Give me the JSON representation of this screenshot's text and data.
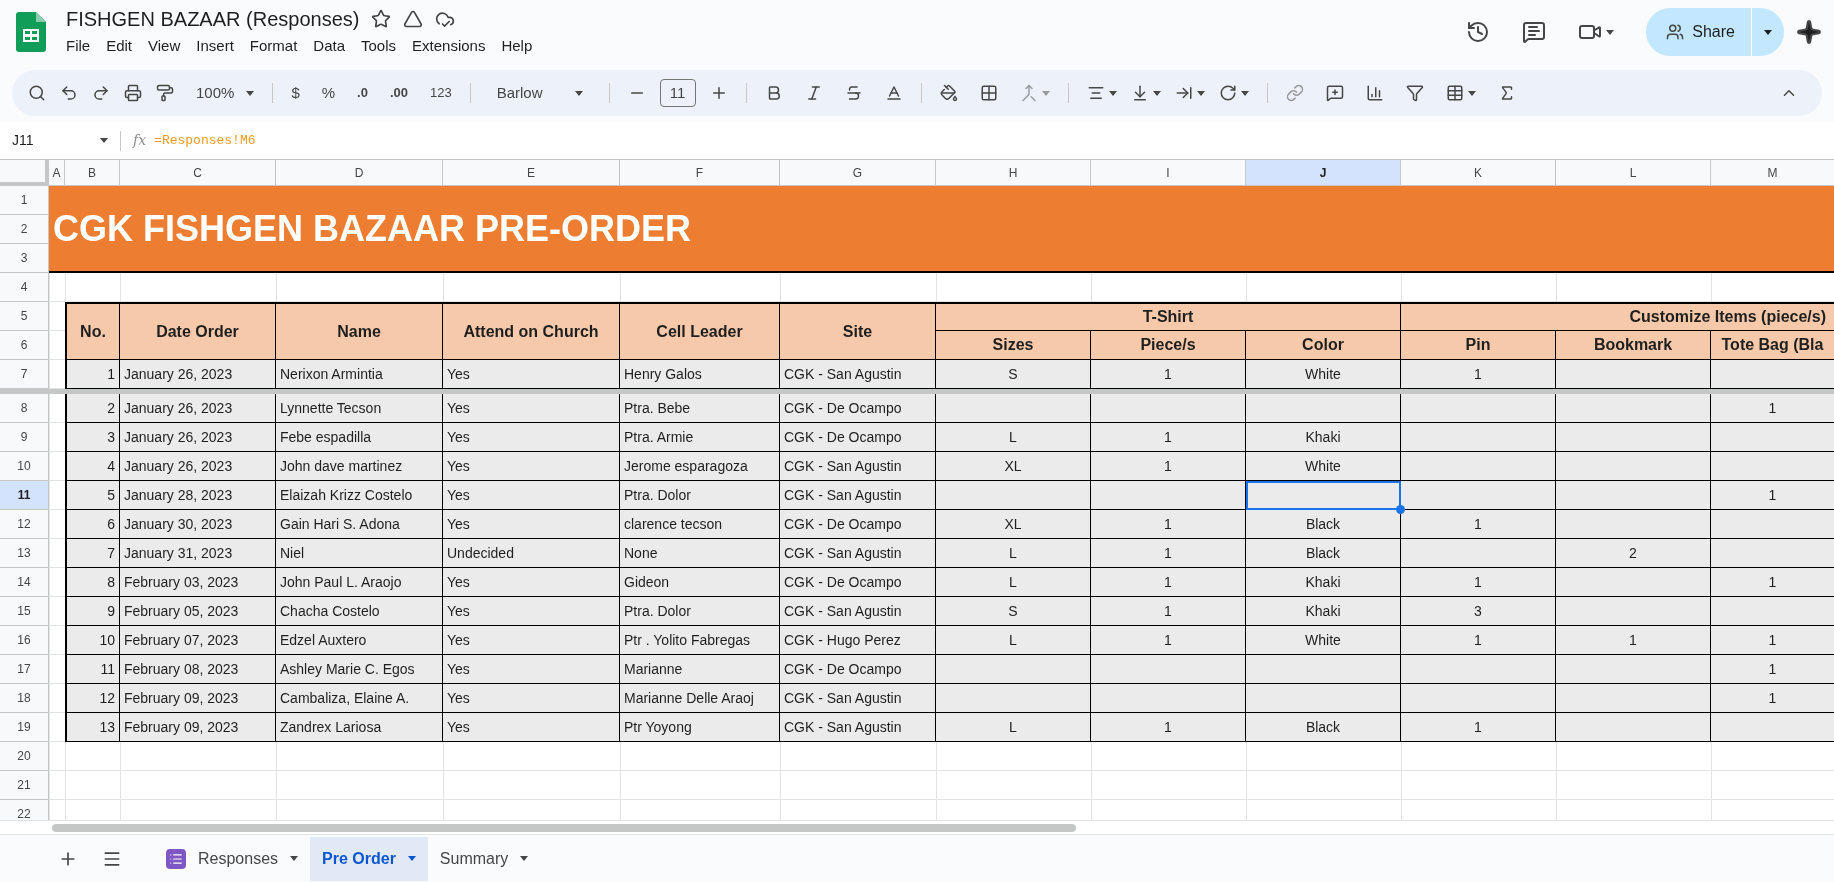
{
  "document": {
    "title": "FISHGEN BAZAAR (Responses)"
  },
  "menu": [
    "File",
    "Edit",
    "View",
    "Insert",
    "Format",
    "Data",
    "Tools",
    "Extensions",
    "Help"
  ],
  "share": {
    "label": "Share"
  },
  "toolbar": {
    "zoom": "100%",
    "currency": "$",
    "percent": "%",
    "decrease_decimals": ".0",
    "increase_decimals": ".00",
    "number_format": "123",
    "font": "Barlow",
    "font_size": "11"
  },
  "formula_bar": {
    "name_box": "J11",
    "fx": "fx",
    "formula": "=Responses!M6"
  },
  "columns": [
    {
      "label": "A",
      "selected": false
    },
    {
      "label": "B",
      "selected": false
    },
    {
      "label": "C",
      "selected": false
    },
    {
      "label": "D",
      "selected": false
    },
    {
      "label": "E",
      "selected": false
    },
    {
      "label": "F",
      "selected": false
    },
    {
      "label": "G",
      "selected": false
    },
    {
      "label": "H",
      "selected": false
    },
    {
      "label": "I",
      "selected": false
    },
    {
      "label": "J",
      "selected": true
    },
    {
      "label": "K",
      "selected": false
    },
    {
      "label": "L",
      "selected": false
    },
    {
      "label": "M",
      "selected": false
    }
  ],
  "rows": [
    {
      "number": "1",
      "selected": false
    },
    {
      "number": "2",
      "selected": false
    },
    {
      "number": "3",
      "selected": false
    },
    {
      "number": "4",
      "selected": false
    },
    {
      "number": "5",
      "selected": false
    },
    {
      "number": "6",
      "selected": false
    },
    {
      "number": "7",
      "selected": false,
      "freeze_below": true
    },
    {
      "number": "8",
      "selected": false
    },
    {
      "number": "9",
      "selected": false
    },
    {
      "number": "10",
      "selected": false
    },
    {
      "number": "11",
      "selected": true
    },
    {
      "number": "12",
      "selected": false
    },
    {
      "number": "13",
      "selected": false
    },
    {
      "number": "14",
      "selected": false
    },
    {
      "number": "15",
      "selected": false
    },
    {
      "number": "16",
      "selected": false
    },
    {
      "number": "17",
      "selected": false
    },
    {
      "number": "18",
      "selected": false
    },
    {
      "number": "19",
      "selected": false
    },
    {
      "number": "20",
      "selected": false
    },
    {
      "number": "21",
      "selected": false
    },
    {
      "number": "22",
      "selected": false
    }
  ],
  "sheet_title": "CGK FISHGEN BAZAAR PRE-ORDER",
  "header": {
    "columns": {
      "no": "No.",
      "date": "Date Order",
      "name": "Name",
      "attend": "Attend on Church",
      "cell_leader": "Cell Leader",
      "site": "Site"
    },
    "groups": [
      {
        "label": "T-Shirt",
        "columns": {
          "size": "Sizes",
          "pieces": "Piece/s",
          "shirt_color": "Color"
        }
      },
      {
        "label": "Customize Items (piece/s)",
        "columns": {
          "pin": "Pin",
          "bookmark": "Bookmark",
          "tote_bag": "Tote Bag (Bla"
        }
      }
    ]
  },
  "orders": [
    {
      "no": "1",
      "date": "January 26, 2023",
      "name": "Nerixon Armintia",
      "attend": "Yes",
      "cell_leader": "Henry Galos",
      "site": "CGK - San Agustin",
      "size": "S",
      "pieces": "1",
      "shirt_color": "White",
      "pin": "1"
    },
    {
      "no": "2",
      "date": "January 26, 2023",
      "name": "Lynnette Tecson",
      "attend": "Yes",
      "cell_leader": "Ptra. Bebe",
      "site": "CGK - De Ocampo",
      "tote_bag": "1"
    },
    {
      "no": "3",
      "date": "January 26, 2023",
      "name": "Febe espadilla",
      "attend": "Yes",
      "cell_leader": "Ptra. Armie",
      "site": "CGK - De Ocampo",
      "size": "L",
      "pieces": "1",
      "shirt_color": "Khaki"
    },
    {
      "no": "4",
      "date": "January 26, 2023",
      "name": "John dave martinez",
      "attend": "Yes",
      "cell_leader": "Jerome esparagoza",
      "site": "CGK - San Agustin",
      "size": "XL",
      "pieces": "1",
      "shirt_color": "White"
    },
    {
      "no": "5",
      "date": "January 28, 2023",
      "name": "Elaizah Krizz Costelo",
      "attend": "Yes",
      "cell_leader": "Ptra. Dolor",
      "site": "CGK - San Agustin",
      "tote_bag": "1"
    },
    {
      "no": "6",
      "date": "January 30, 2023",
      "name": "Gain Hari S. Adona",
      "attend": "Yes",
      "cell_leader": "clarence tecson",
      "site": "CGK - De Ocampo",
      "size": "XL",
      "pieces": "1",
      "shirt_color": "Black",
      "pin": "1"
    },
    {
      "no": "7",
      "date": "January 31, 2023",
      "name": "Niel",
      "attend": "Undecided",
      "cell_leader": "None",
      "site": "CGK - San Agustin",
      "size": "L",
      "pieces": "1",
      "shirt_color": "Black",
      "bookmark": "2"
    },
    {
      "no": "8",
      "date": "February 03, 2023",
      "name": "John Paul L. Araojo",
      "attend": "Yes",
      "cell_leader": "Gideon",
      "site": "CGK - De Ocampo",
      "size": "L",
      "pieces": "1",
      "shirt_color": "Khaki",
      "pin": "1",
      "tote_bag": "1"
    },
    {
      "no": "9",
      "date": "February 05, 2023",
      "name": "Chacha Costelo",
      "attend": "Yes",
      "cell_leader": "Ptra. Dolor",
      "site": "CGK - San Agustin",
      "size": "S",
      "pieces": "1",
      "shirt_color": "Khaki",
      "pin": "3"
    },
    {
      "no": "10",
      "date": "February 07, 2023",
      "name": "Edzel Auxtero",
      "attend": "Yes",
      "cell_leader": "Ptr . Yolito Fabregas",
      "site": "CGK - Hugo Perez",
      "size": "L",
      "pieces": "1",
      "shirt_color": "White",
      "pin": "1",
      "bookmark": "1",
      "tote_bag": "1"
    },
    {
      "no": "11",
      "date": "February 08, 2023",
      "name": "Ashley Marie C. Egos",
      "attend": "Yes",
      "cell_leader": "Marianne",
      "site": "CGK - De Ocampo",
      "tote_bag": "1"
    },
    {
      "no": "12",
      "date": "February 09, 2023",
      "name": "Cambaliza, Elaine A.",
      "attend": "Yes",
      "cell_leader": "Marianne Delle Araoj",
      "site": "CGK - San Agustin",
      "tote_bag": "1"
    },
    {
      "no": "13",
      "date": "February 09, 2023",
      "name": "Zandrex Lariosa",
      "attend": "Yes",
      "cell_leader": "Ptr Yoyong",
      "site": "CGK - San Agustin",
      "size": "L",
      "pieces": "1",
      "shirt_color": "Black",
      "pin": "1"
    }
  ],
  "sheet_tabs": [
    {
      "label": "Responses",
      "kind": "form",
      "selected": false
    },
    {
      "label": "Pre Order",
      "kind": "plain",
      "selected": true
    },
    {
      "label": "Summary",
      "kind": "plain",
      "selected": false
    }
  ]
}
